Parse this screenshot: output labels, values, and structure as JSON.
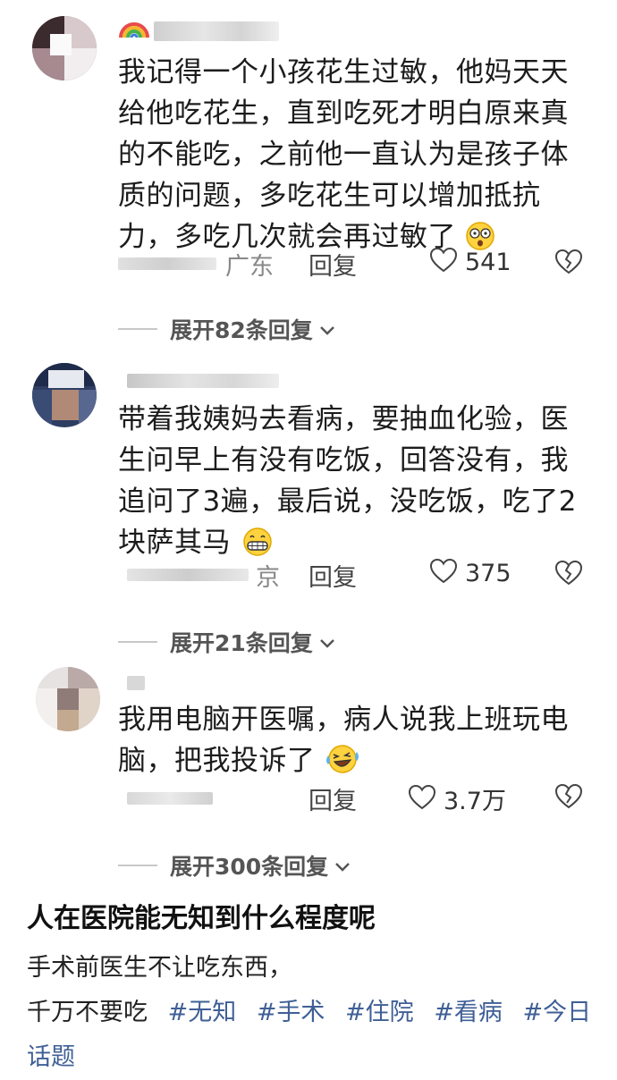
{
  "comments": [
    {
      "text": "我记得一个小孩花生过敏，他妈天天给他吃花生，直到吃死才明白原来真的不能吃，之前他一直认为是孩子体质的问题，多吃花生可以增加抵抗力，多吃几次就会再过敏了",
      "location": "广东",
      "reply_label": "回复",
      "likes": "541",
      "emoji": "astonished-face",
      "expand": "展开82条回复"
    },
    {
      "text": "带着我姨妈去看病，要抽血化验，医生问早上有没有吃饭，回答没有，我追问了3遍，最后说，没吃饭，吃了2块萨其马",
      "location": "京",
      "reply_label": "回复",
      "likes": "375",
      "emoji": "grinning-face",
      "expand": "展开21条回复"
    },
    {
      "text": "我用电脑开医嘱，病人说我上班玩电脑，把我投诉了",
      "location": "",
      "reply_label": "回复",
      "likes": "3.7万",
      "emoji": "laughing-tears-face",
      "expand": "展开300条回复"
    }
  ],
  "post": {
    "title": "人在医院能无知到什么程度呢",
    "line1": "手术前医生不让吃东西，",
    "line2_prefix": "千万不要吃",
    "tags": [
      "#无知",
      "#手术",
      "#住院",
      "#看病",
      "#今日话题"
    ]
  },
  "colors": {
    "tag": "#3f5f96",
    "meta": "#888888"
  }
}
